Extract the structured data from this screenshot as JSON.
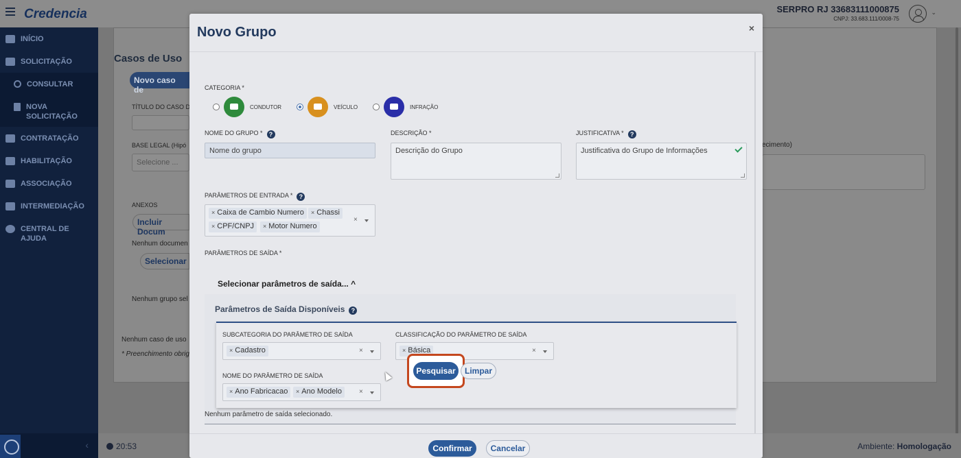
{
  "app": {
    "brand": "Credencia",
    "org_name": "SERPRO RJ 33683111000875",
    "org_cnpj": "CNPJ: 33.683.111/0008-75"
  },
  "sidebar": {
    "items": [
      {
        "label": "INÍCIO",
        "icon": "home-icon"
      },
      {
        "label": "SOLICITAÇÃO",
        "icon": "edit-icon"
      },
      {
        "label": "CONSULTAR",
        "icon": "search-icon"
      },
      {
        "label": "NOVA SOLICITAÇÃO",
        "icon": "document-icon"
      },
      {
        "label": "CONTRATAÇÃO",
        "icon": "handshake-icon"
      },
      {
        "label": "HABILITAÇÃO",
        "icon": "id-card-icon"
      },
      {
        "label": "ASSOCIAÇÃO",
        "icon": "users-icon"
      },
      {
        "label": "INTERMEDIAÇÃO",
        "icon": "user-tie-icon"
      },
      {
        "label": "CENTRAL DE AJUDA",
        "icon": "question-icon"
      }
    ]
  },
  "background_page": {
    "title": "Casos de Uso",
    "new_case_button": "Novo caso de",
    "titulo_label": "TÍTULO DO CASO D",
    "base_legal_label": "BASE LEGAL (Hipó",
    "base_legal_placeholder": "Selecione ...",
    "anexos_label": "ANEXOS",
    "incluir_doc": "Incluir Docum",
    "nenhum_documento": "Nenhum documen",
    "selecionar_btn": "Selecionar",
    "nenhum_grupo": "Nenhum grupo sel",
    "nenhum_caso": "Nenhum caso de uso",
    "preenchimento": "* Preenchimento obrig",
    "right_label": "ecimento)"
  },
  "footer": {
    "time": "20:53",
    "ambiente_label": "Ambiente:",
    "ambiente_value": "Homologação"
  },
  "modal": {
    "title": "Novo Grupo",
    "close": "×",
    "categoria_label": "CATEGORIA *",
    "categories": [
      {
        "label": "CONDUTOR",
        "selected": false,
        "color": "#2e8a3c",
        "icon": "id-card-icon"
      },
      {
        "label": "VEÍCULO",
        "selected": true,
        "color": "#d8901e",
        "icon": "car-icon"
      },
      {
        "label": "INFRAÇÃO",
        "selected": false,
        "color": "#2a2ea8",
        "icon": "document-icon"
      }
    ],
    "nome_label": "NOME DO GRUPO *",
    "nome_value": "Nome do grupo",
    "descricao_label": "DESCRIÇÃO *",
    "descricao_value": "Descrição do Grupo",
    "justificativa_label": "JUSTIFICATIVA *",
    "justificativa_value": "Justificativa do Grupo de Informações",
    "entrada_label": "PARÂMETROS DE ENTRADA *",
    "entrada_chips": [
      "Caixa de Cambio Numero",
      "Chassi",
      "CPF/CNPJ",
      "Motor Numero"
    ],
    "saida_label": "PARÂMETROS DE SAÍDA *",
    "saida_toggle": "Selecionar parâmetros de saída...",
    "disponiveis_title": "Parâmetros de Saída Disponíveis",
    "subcategoria_label": "SUBCATEGORIA DO PARÂMETRO DE SAÍDA",
    "subcategoria_chips": [
      "Cadastro"
    ],
    "classificacao_label": "CLASSIFICAÇÃO DO PARÂMETRO DE SAÍDA",
    "classificacao_chips": [
      "Básica"
    ],
    "nome_param_label": "NOME DO PARÂMETRO DE SAÍDA",
    "nome_param_chips": [
      "Ano Fabricacao",
      "Ano Modelo"
    ],
    "pesquisar": "Pesquisar",
    "limpar": "Limpar",
    "nenhum_param": "Nenhum parâmetro de saída selecionado.",
    "confirmar": "Confirmar",
    "cancelar": "Cancelar"
  }
}
